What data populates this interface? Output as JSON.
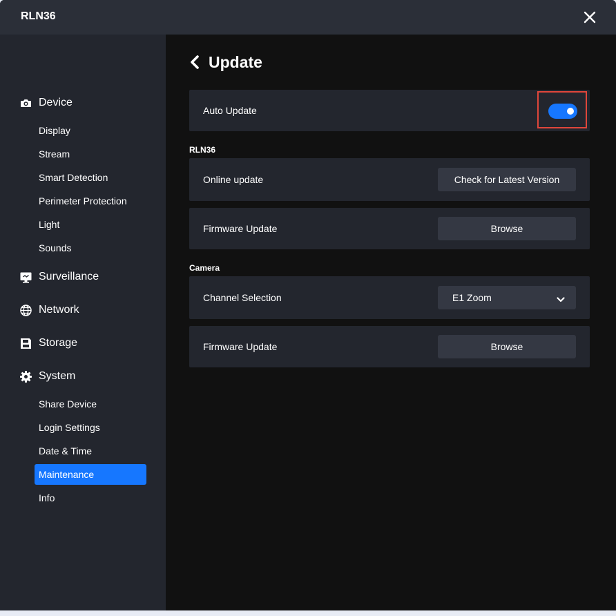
{
  "window": {
    "title": "RLN36"
  },
  "sidebar": {
    "sections": [
      {
        "label": "Device",
        "icon": "camera-icon"
      },
      {
        "label": "Surveillance",
        "icon": "monitor-icon"
      },
      {
        "label": "Network",
        "icon": "globe-icon"
      },
      {
        "label": "Storage",
        "icon": "floppy-disk-icon"
      },
      {
        "label": "System",
        "icon": "gear-icon"
      }
    ],
    "device_items": [
      "Display",
      "Stream",
      "Smart Detection",
      "Perimeter Protection",
      "Light",
      "Sounds"
    ],
    "system_items": [
      "Share Device",
      "Login Settings",
      "Date & Time",
      "Maintenance",
      "Info"
    ],
    "active_item": "Maintenance"
  },
  "page": {
    "title": "Update",
    "auto_update": {
      "label": "Auto Update",
      "enabled": true
    },
    "device_group": {
      "label": "RLN36",
      "online_update_label": "Online update",
      "online_update_button": "Check for Latest Version",
      "firmware_label": "Firmware Update",
      "firmware_button": "Browse"
    },
    "camera_group": {
      "label": "Camera",
      "channel_label": "Channel Selection",
      "channel_value": "E1 Zoom",
      "firmware_label": "Firmware Update",
      "firmware_button": "Browse"
    }
  },
  "colors": {
    "accent": "#1677ff",
    "highlight_border": "#e0463b",
    "sidebar_bg": "#23262e",
    "content_bg": "#111111",
    "card_bg": "#23262e",
    "button_bg": "#343843"
  }
}
